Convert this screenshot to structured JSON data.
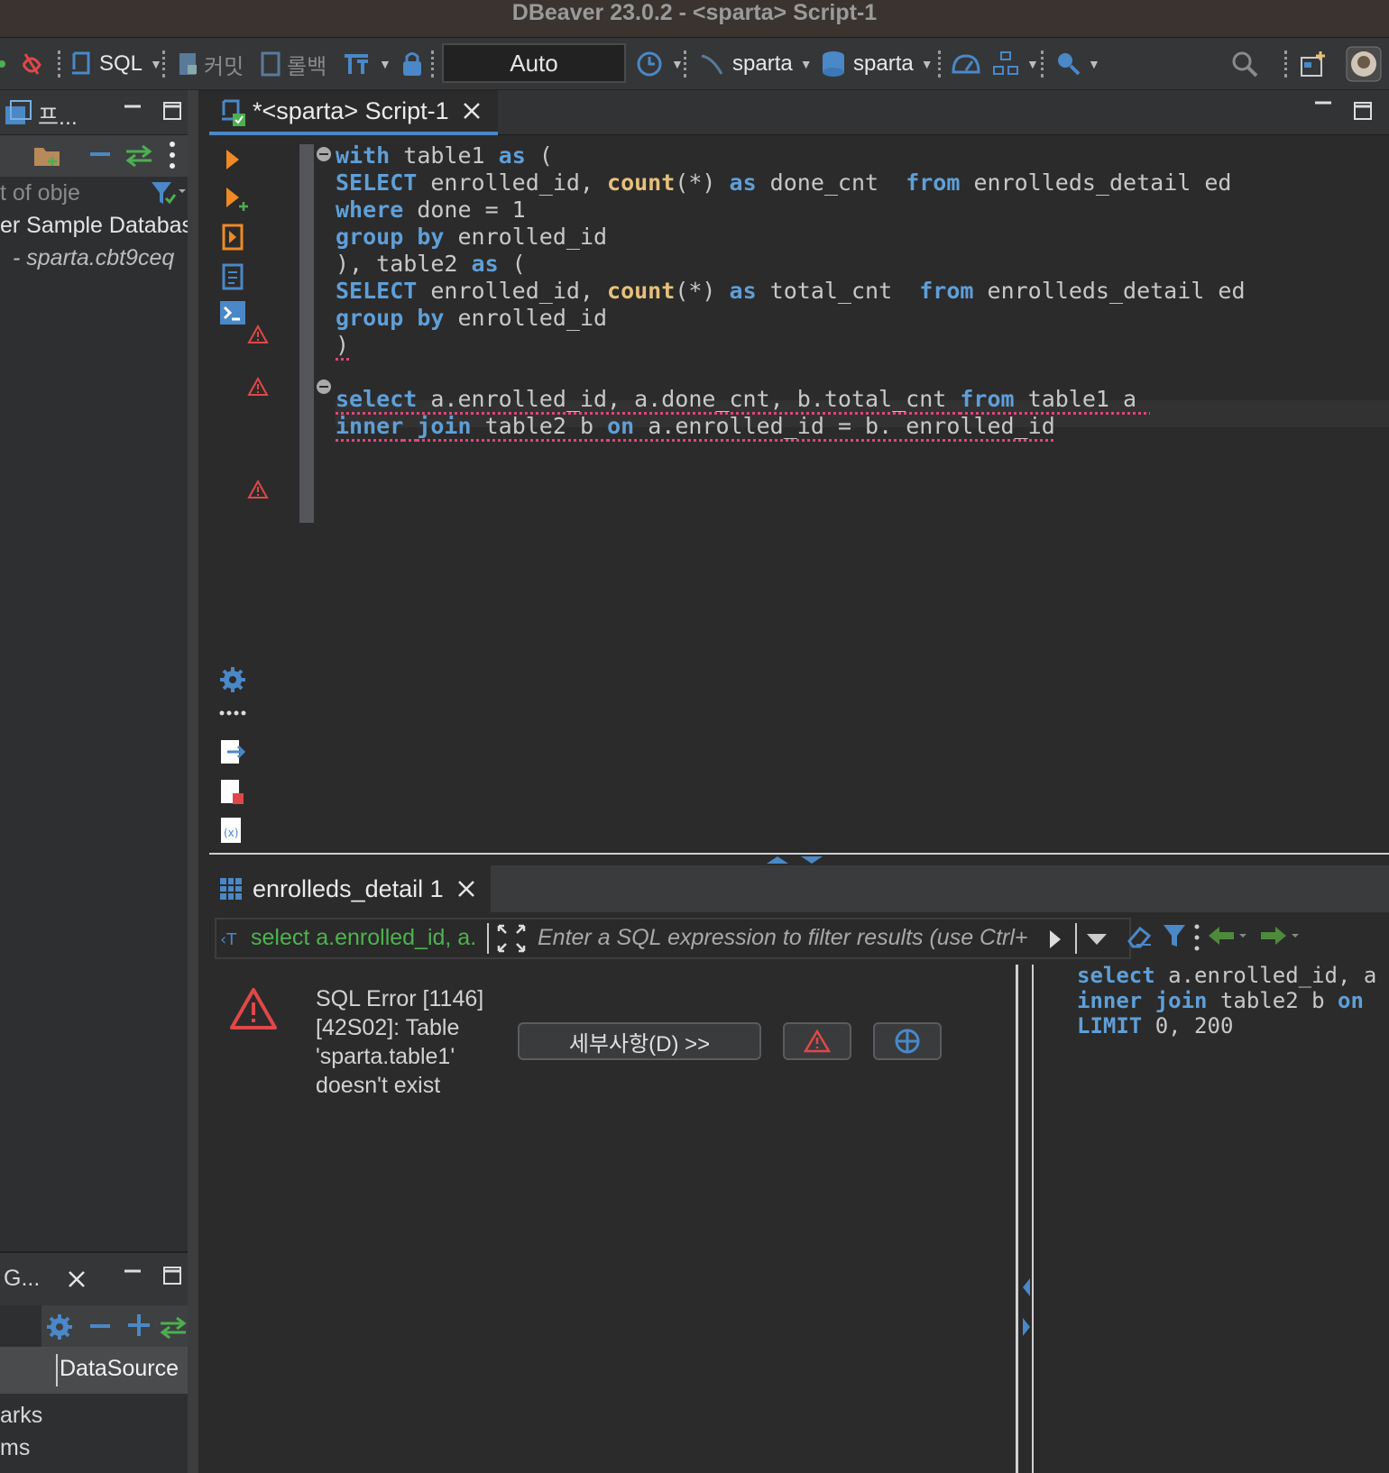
{
  "window": {
    "title": "DBeaver 23.0.2 - <sparta> Script-1"
  },
  "toolbar": {
    "sql_label": "SQL",
    "commit_label": "커밋",
    "rollback_label": "롤백",
    "transaction_mode": "Auto",
    "datasource": "sparta",
    "schema": "sparta"
  },
  "navigator": {
    "tab_label": "프...",
    "filter_placeholder": "t of obje",
    "items": [
      "er Sample Databas",
      "- sparta.cbt9ceq"
    ]
  },
  "bottom_left_panel": {
    "tab_label": "G...",
    "column_header": "DataSource",
    "items": [
      "arks",
      "ms"
    ]
  },
  "editor": {
    "tab_label": "*<sparta> Script-1"
  },
  "results": {
    "tab_label": "enrolleds_detail 1",
    "filter_query": "select a.enrolled_id, a.",
    "filter_placeholder": "Enter a SQL expression to filter results (use Ctrl+",
    "error_message": "SQL Error [1146] [42S02]: Table 'sparta.table1' doesn't exist",
    "details_button": "세부사항(D) >>",
    "query_lines": [
      "select a.enrolled_id, a",
      "inner join table2 b on",
      "LIMIT 0, 200"
    ]
  },
  "colors": {
    "keyword": "#5f9fd8",
    "function": "#e6c07b",
    "error": "#e0457b",
    "accent": "#4a88c7"
  }
}
